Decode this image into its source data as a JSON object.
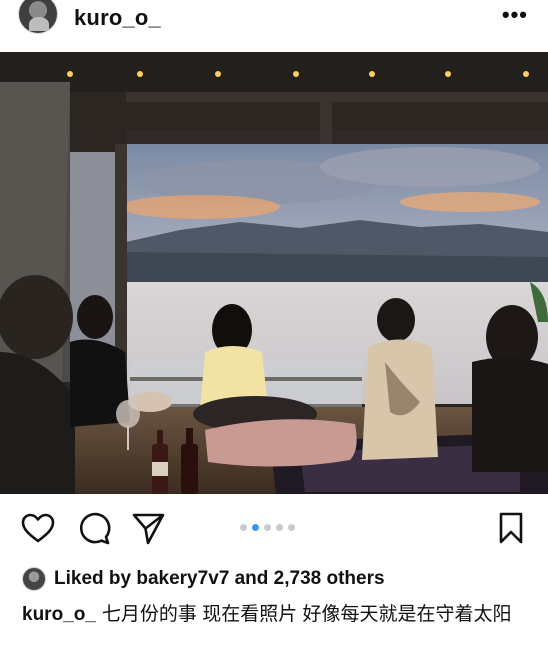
{
  "header": {
    "username": "kuro_o_",
    "more_label": "•••"
  },
  "carousel": {
    "count": 5,
    "active_index": 1
  },
  "likes": {
    "prefix": "Liked by ",
    "user": "bakery7v7",
    "middle": " and ",
    "count": "2,738 others"
  },
  "caption": {
    "username": "kuro_o_",
    "text": "七月份的事 现在看照片 好像每天就是在守着太阳"
  },
  "icons": {
    "like": "heart-icon",
    "comment": "comment-bubble-icon",
    "share": "paper-plane-icon",
    "save": "bookmark-icon",
    "more": "more-dots-icon"
  },
  "colors": {
    "accent_dot": "#3897f0",
    "inactive_dot": "#c9c9c9",
    "text": "#111111"
  }
}
